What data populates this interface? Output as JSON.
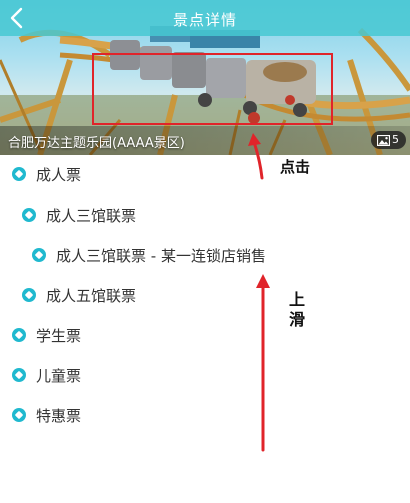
{
  "header": {
    "title": "景点详情",
    "back_icon": "chevron-left-icon"
  },
  "hero": {
    "caption": "合肥万达主题乐园(AAAA景区)",
    "photo_count": "5",
    "photo_icon": "image-icon"
  },
  "tickets": [
    {
      "label": "成人票"
    },
    {
      "label": "成人三馆联票"
    },
    {
      "label": "成人三馆联票 - 某一连锁店销售"
    },
    {
      "label": "成人五馆联票"
    },
    {
      "label": "学生票"
    },
    {
      "label": "儿童票"
    },
    {
      "label": "特惠票"
    }
  ],
  "annotations": {
    "click_label": "点击",
    "swipe_label": "上滑"
  },
  "colors": {
    "nav_bg": "#46c8d2",
    "accent": "#20b9cf",
    "annotation_red": "#e0242a"
  }
}
